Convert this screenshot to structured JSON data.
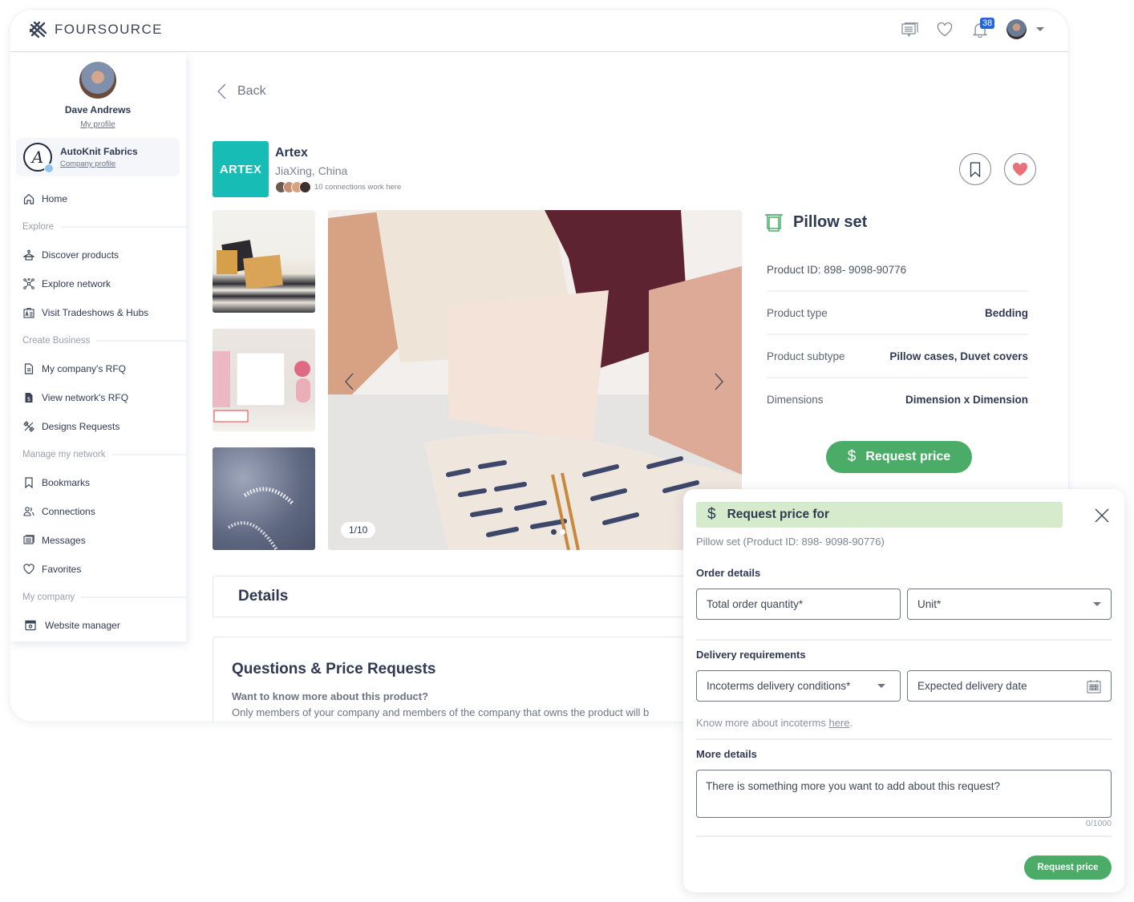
{
  "app": {
    "brand": "FOURSOURCE",
    "notifications_count": "38"
  },
  "sidebar": {
    "user_name": "Dave Andrews",
    "my_profile_link": "My profile",
    "company_name": "AutoKnit Fabrics",
    "company_profile_link": "Company profile",
    "home": "Home",
    "sections": {
      "explore": "Explore",
      "create_business": "Create Business",
      "manage_network": "Manage my network",
      "my_company": "My company"
    },
    "items": {
      "discover_products": "Discover products",
      "explore_network": "Explore network",
      "tradeshows": "Visit Tradeshows & Hubs",
      "my_rfq": "My company's RFQ",
      "network_rfq": "View network's RFQ",
      "design_requests": "Designs Requests",
      "bookmarks": "Bookmarks",
      "connections": "Connections",
      "messages": "Messages",
      "favorites": "Favorites",
      "website_manager": "Website manager"
    }
  },
  "page": {
    "back_label": "Back",
    "supplier": {
      "logo_text": "ARTEX",
      "name": "Artex",
      "location": "JiaXing, China",
      "connections_text": "10 connections work here"
    },
    "gallery": {
      "counter": "1/10",
      "thumbnails": [
        "Pillows on striped sofa",
        "White pillow with pink throw",
        "Grey fringed blanket"
      ]
    },
    "product": {
      "title": "Pillow set",
      "id_line": "Product ID: 898- 9098-90776",
      "specs": [
        {
          "label": "Product type",
          "value": "Bedding"
        },
        {
          "label": "Product subtype",
          "value": "Pillow cases, Duvet covers"
        },
        {
          "label": "Dimensions",
          "value": "Dimension x Dimension"
        }
      ],
      "request_price_label": "Request price"
    },
    "details_title": "Details",
    "qa": {
      "title": "Questions & Price Requests",
      "subtitle": "Want to know more about this product?",
      "text": "Only members of your company and members of the company that owns the product will b"
    }
  },
  "modal": {
    "title": "Request price for",
    "subtitle": "Pillow set (Product ID: 898- 9098-90776)",
    "order_details_label": "Order details",
    "quantity_placeholder": "Total order quantity*",
    "unit_placeholder": "Unit*",
    "delivery_label": "Delivery requirements",
    "incoterms_placeholder": "Incoterms delivery conditions*",
    "delivery_date_placeholder": "Expected delivery date",
    "hint_prefix": "Know more about incoterms ",
    "hint_link": "here",
    "hint_suffix": ".",
    "more_details_label": "More details",
    "textarea_placeholder": "There is something  more you want to add about this request?",
    "char_count": "0/1000",
    "submit_label": "Request price"
  },
  "colors": {
    "accent_green": "#4bac68",
    "header_green_bg": "#d5ebcb",
    "supplier_teal": "#17bdb4",
    "badge_blue": "#2466d9",
    "favorite_red": "#e8717a"
  }
}
